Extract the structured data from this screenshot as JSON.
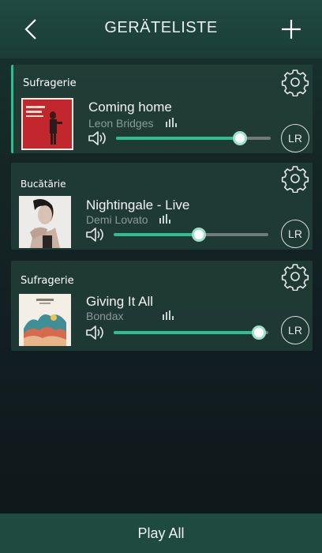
{
  "header": {
    "title": "GERÄTELISTE"
  },
  "devices": [
    {
      "room": "Sufragerie",
      "song": "Coming home",
      "artist": "Leon Bridges",
      "volume": 0.8,
      "output": "LR",
      "active": true
    },
    {
      "room": "Bucătărie",
      "song": "Nightingale - Live",
      "artist": "Demi Lovato",
      "volume": 0.55,
      "output": "LR",
      "active": false
    },
    {
      "room": "Sufragerie",
      "song": "Giving It All",
      "artist": "Bondax",
      "volume": 0.94,
      "output": "LR",
      "active": false
    }
  ],
  "footer": {
    "play_all_label": "Play All"
  },
  "colors": {
    "accent": "#2dbf8f",
    "track": "#6f7a79"
  }
}
